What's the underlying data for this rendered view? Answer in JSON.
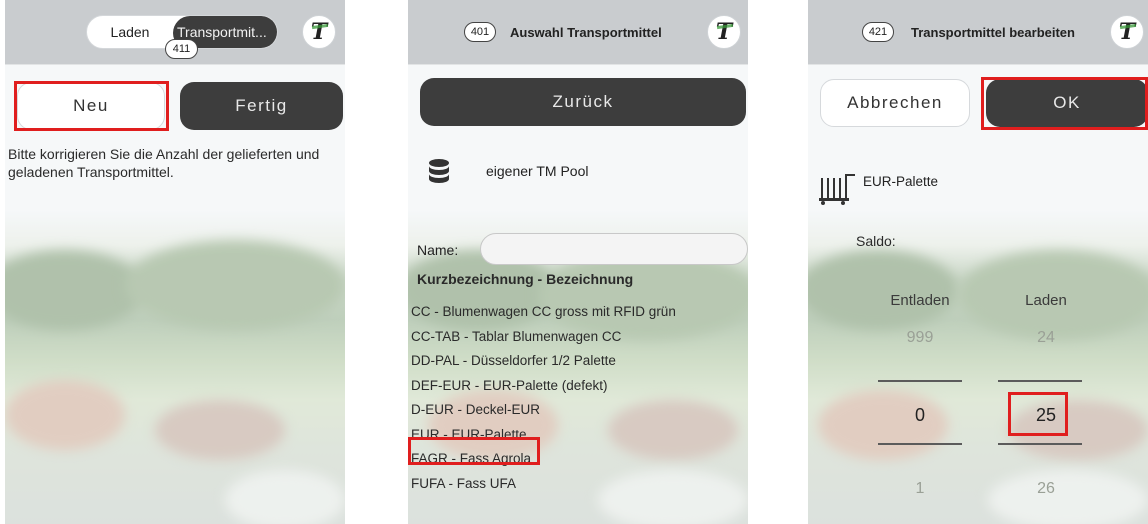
{
  "screen1": {
    "segment_left": "Laden",
    "segment_right": "Transportmit...",
    "badge": "411",
    "logo": "T",
    "new_button": "Neu",
    "done_button": "Fertig",
    "hint": "Bitte korrigieren Sie die Anzahl der gelieferten und geladenen Transportmittel."
  },
  "screen2": {
    "badge": "401",
    "title": "Auswahl Transportmittel",
    "logo": "T",
    "back_button": "Zurück",
    "pool_label": "eigener TM Pool",
    "name_label": "Name:",
    "name_value": "",
    "list_header": "Kurzbezeichnung  -  Bezeichnung",
    "items": [
      "CC - Blumenwagen CC gross mit RFID grün",
      "CC-TAB - Tablar Blumenwagen CC",
      "DD-PAL - Düsseldorfer 1/2 Palette",
      "DEF-EUR - EUR-Palette (defekt)",
      "D-EUR - Deckel-EUR",
      "EUR - EUR-Palette",
      "FAGR - Fass Agrola",
      "FUFA - Fass UFA"
    ],
    "selected_index": 5
  },
  "screen3": {
    "badge": "421",
    "title": "Transportmittel bearbeiten",
    "logo": "T",
    "cancel_button": "Abbrechen",
    "ok_button": "OK",
    "item_label": "EUR-Palette",
    "saldo_label": "Saldo:",
    "col_unload": "Entladen",
    "col_load": "Laden",
    "unload_prev": "999",
    "unload_value": "0",
    "unload_next": "1",
    "load_prev": "24",
    "load_value": "25",
    "load_next": "26"
  },
  "colors": {
    "highlight": "#e01e1e",
    "dark_button": "#3d3d3d",
    "header": "#c9cccf"
  }
}
